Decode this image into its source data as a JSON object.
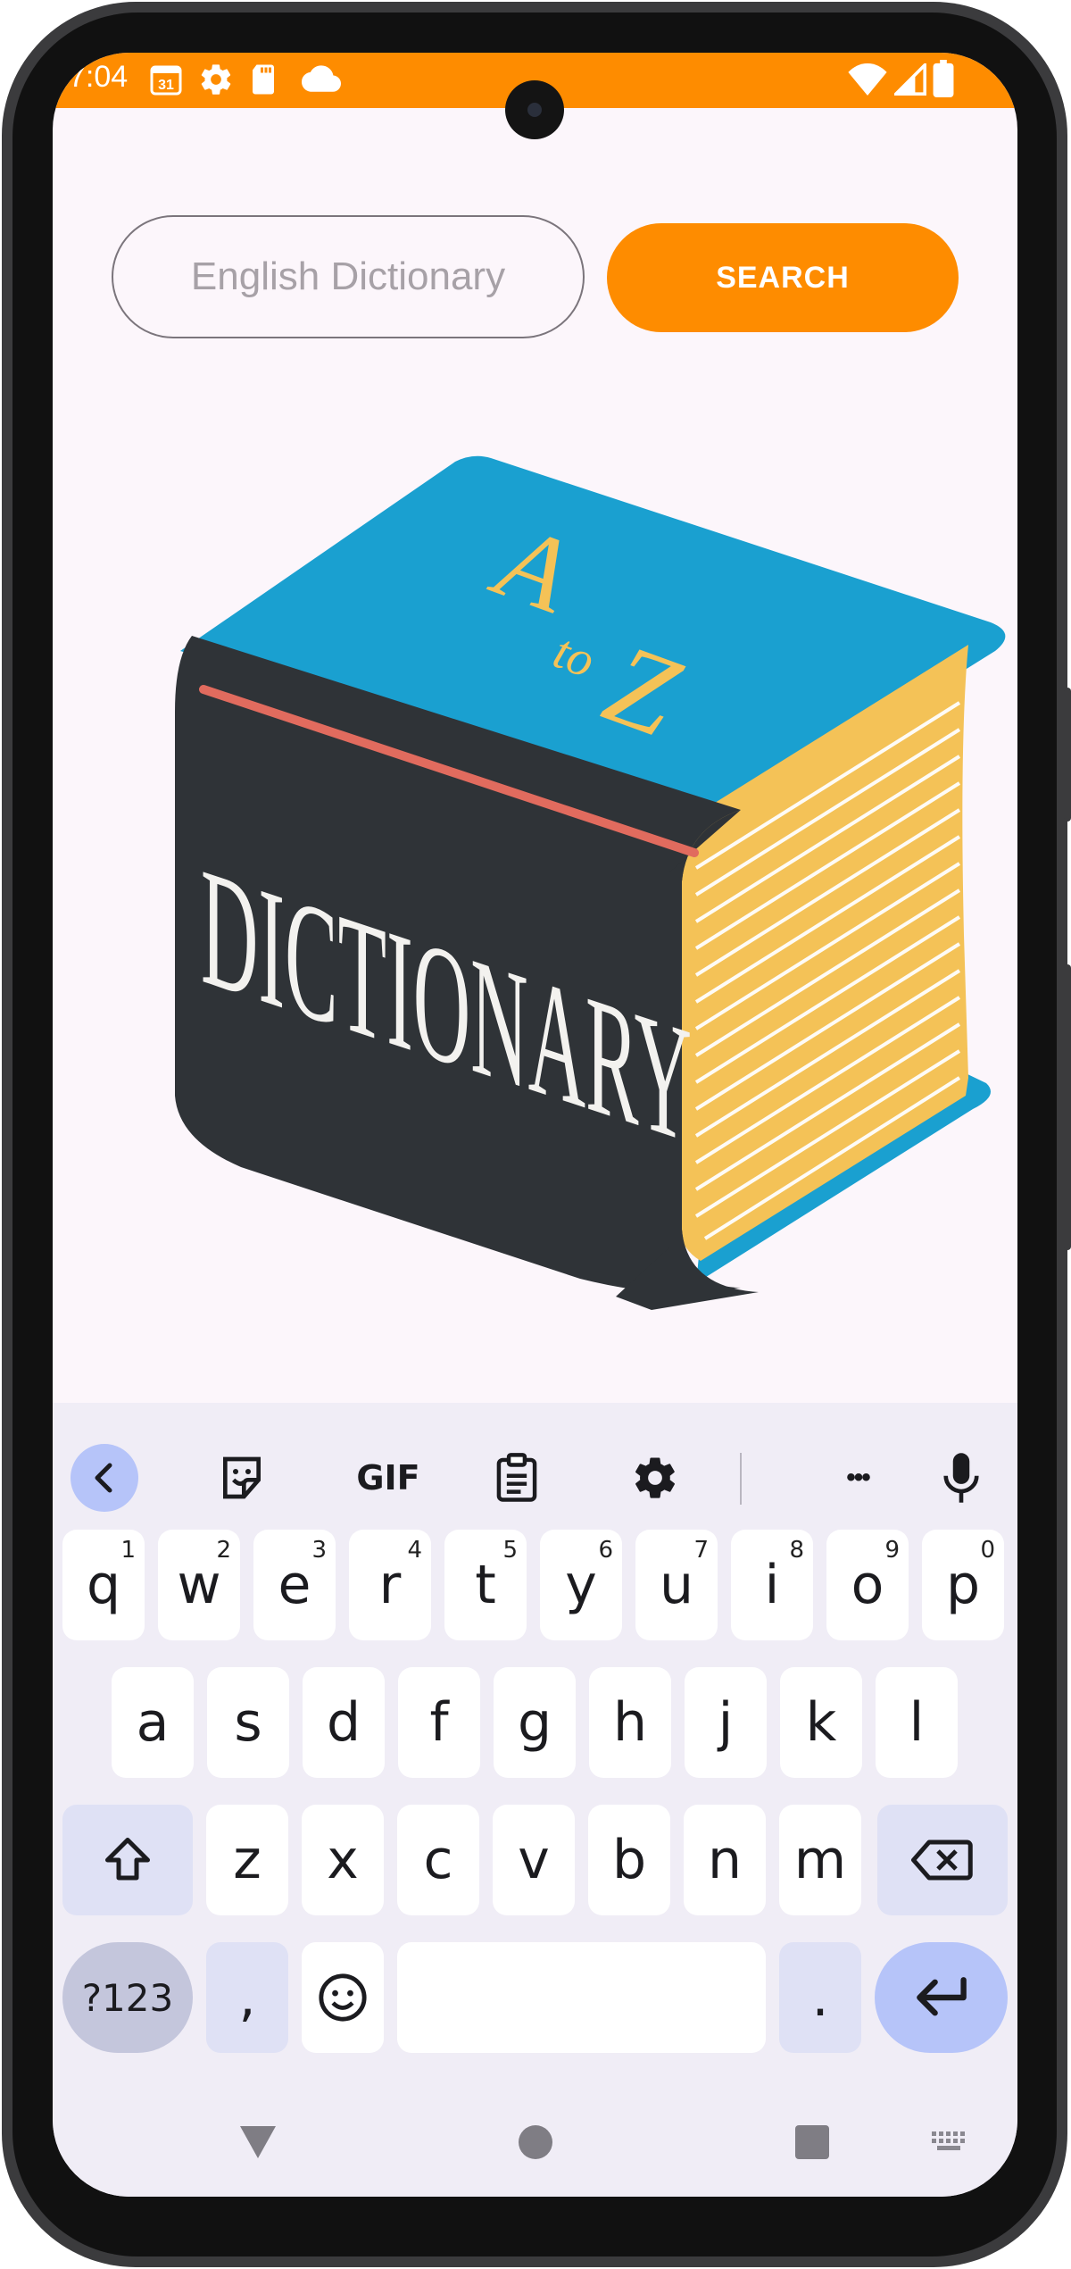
{
  "status_bar": {
    "time": "7:04",
    "calendar_day": "31",
    "icons_left": [
      "calendar-icon",
      "settings-icon",
      "sd-card-icon",
      "cloud-icon"
    ],
    "icons_right": [
      "wifi-icon",
      "signal-icon",
      "battery-icon"
    ],
    "color": "#fe8c00"
  },
  "search": {
    "placeholder": "English Dictionary",
    "button_label": "SEARCH"
  },
  "illustration": {
    "cover_title": "DICTIONARY",
    "top_letter_a": "A",
    "top_word_to": "to",
    "top_letter_z": "Z",
    "colors": {
      "cover": "#2f3337",
      "top": "#1aa0d0",
      "pages": "#f4c257",
      "accent_line": "#e16b5e"
    }
  },
  "keyboard": {
    "toolbar": [
      "back-chevron-icon",
      "sticker-icon",
      "gif-icon",
      "clipboard-icon",
      "gear-icon",
      "more-icon",
      "mic-icon"
    ],
    "gif_label": "GIF",
    "more_label": "•••",
    "row1": [
      {
        "key": "q",
        "hint": "1"
      },
      {
        "key": "w",
        "hint": "2"
      },
      {
        "key": "e",
        "hint": "3"
      },
      {
        "key": "r",
        "hint": "4"
      },
      {
        "key": "t",
        "hint": "5"
      },
      {
        "key": "y",
        "hint": "6"
      },
      {
        "key": "u",
        "hint": "7"
      },
      {
        "key": "i",
        "hint": "8"
      },
      {
        "key": "o",
        "hint": "9"
      },
      {
        "key": "p",
        "hint": "0"
      }
    ],
    "row2": [
      "a",
      "s",
      "d",
      "f",
      "g",
      "h",
      "j",
      "k",
      "l"
    ],
    "row3": [
      "z",
      "x",
      "c",
      "v",
      "b",
      "n",
      "m"
    ],
    "symbols_label": "?123",
    "comma_label": ",",
    "period_label": ".",
    "accent": "#b6c4f9"
  },
  "nav_bar": [
    "back-icon",
    "home-icon",
    "recents-icon",
    "keyboard-switch-icon"
  ]
}
